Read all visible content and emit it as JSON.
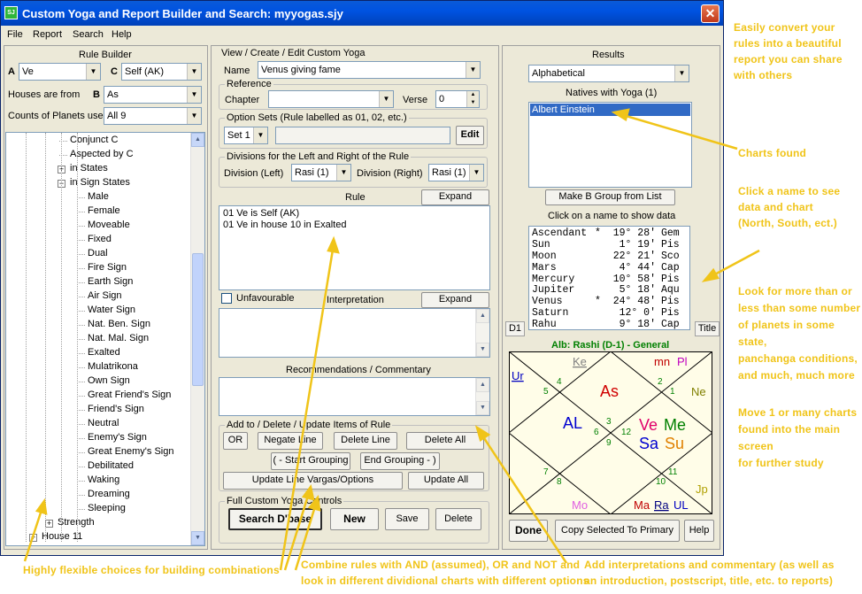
{
  "window": {
    "title": "Custom Yoga and Report Builder and Search: myyogas.sjy",
    "app_icon": "yoga-app-icon",
    "close": "✕"
  },
  "menu": [
    "File",
    "Report",
    "Search",
    "Help"
  ],
  "rule_builder": {
    "title": "Rule Builder",
    "a_label": "A",
    "a_value": "Ve",
    "c_label": "C",
    "c_value": "Self (AK)",
    "houses_label": "Houses are from",
    "b_label": "B",
    "b_value": "As",
    "counts_label": "Counts of Planets use",
    "counts_value": "All 9"
  },
  "tree": [
    {
      "label": "Conjunct C",
      "indent": 2,
      "exp": ""
    },
    {
      "label": "Aspected by C",
      "indent": 2,
      "exp": ""
    },
    {
      "label": "in States",
      "indent": 2,
      "exp": "+"
    },
    {
      "label": "in Sign States",
      "indent": 2,
      "exp": "-"
    },
    {
      "label": "Male",
      "indent": 3,
      "exp": ""
    },
    {
      "label": "Female",
      "indent": 3,
      "exp": ""
    },
    {
      "label": "Moveable",
      "indent": 3,
      "exp": ""
    },
    {
      "label": "Fixed",
      "indent": 3,
      "exp": ""
    },
    {
      "label": "Dual",
      "indent": 3,
      "exp": ""
    },
    {
      "label": "Fire Sign",
      "indent": 3,
      "exp": ""
    },
    {
      "label": "Earth Sign",
      "indent": 3,
      "exp": ""
    },
    {
      "label": "Air Sign",
      "indent": 3,
      "exp": ""
    },
    {
      "label": "Water Sign",
      "indent": 3,
      "exp": ""
    },
    {
      "label": "Nat. Ben. Sign",
      "indent": 3,
      "exp": ""
    },
    {
      "label": "Nat. Mal. Sign",
      "indent": 3,
      "exp": ""
    },
    {
      "label": "Exalted",
      "indent": 3,
      "exp": ""
    },
    {
      "label": "Mulatrikona",
      "indent": 3,
      "exp": ""
    },
    {
      "label": "Own Sign",
      "indent": 3,
      "exp": ""
    },
    {
      "label": "Great Friend's Sign",
      "indent": 3,
      "exp": ""
    },
    {
      "label": "Friend's Sign",
      "indent": 3,
      "exp": ""
    },
    {
      "label": "Neutral",
      "indent": 3,
      "exp": ""
    },
    {
      "label": "Enemy's Sign",
      "indent": 3,
      "exp": ""
    },
    {
      "label": "Great Enemy's Sign",
      "indent": 3,
      "exp": ""
    },
    {
      "label": "Debilitated",
      "indent": 3,
      "exp": ""
    },
    {
      "label": "Waking",
      "indent": 3,
      "exp": ""
    },
    {
      "label": "Dreaming",
      "indent": 3,
      "exp": ""
    },
    {
      "label": "Sleeping",
      "indent": 3,
      "exp": ""
    },
    {
      "label": "Strength",
      "indent": 1,
      "exp": "+"
    },
    {
      "label": "House 11",
      "indent": 0,
      "exp": "+"
    }
  ],
  "editor": {
    "section_title": "View / Create / Edit Custom Yoga",
    "name_label": "Name",
    "name_value": "Venus giving fame",
    "reference_title": "Reference",
    "chapter_label": "Chapter",
    "chapter_value": "",
    "verse_label": "Verse",
    "verse_value": "0",
    "option_sets_title": "Option Sets (Rule labelled as 01, 02, etc.)",
    "set_value": "Set 1",
    "set_text": "",
    "edit_label": "Edit",
    "divisions_title": "Divisions for the Left and Right of the Rule",
    "div_left_label": "Division (Left)",
    "div_left_value": "Rasi (1)",
    "div_right_label": "Division (Right)",
    "div_right_value": "Rasi (1)",
    "rule_header": "Rule",
    "expand_label": "Expand",
    "rule_lines": [
      "01  Ve is Self (AK)",
      "01  Ve in house 10 in Exalted"
    ],
    "unfavourable_label": "Unfavourable",
    "interpretation_header": "Interpretation",
    "interpretation_text": "",
    "recommendations_header": "Recommendations / Commentary",
    "recommendations_text": "",
    "items_title": "Add to / Delete / Update Items of Rule",
    "or_label": "OR",
    "negate_label": "Negate Line",
    "delete_line_label": "Delete Line",
    "delete_all_label": "Delete All",
    "start_grouping_label": "( - Start Grouping",
    "end_grouping_label": "End Grouping - )",
    "update_line_label": "Update Line Vargas/Options",
    "update_all_label": "Update All",
    "controls_title": "Full Custom Yoga Controls",
    "search_label": "Search D'base",
    "new_label": "New",
    "save_label": "Save",
    "delete_label": "Delete"
  },
  "results": {
    "title": "Results",
    "sort_value": "Alphabetical",
    "natives_label": "Natives with Yoga (1)",
    "natives": [
      "Albert Einstein"
    ],
    "make_group_label": "Make B Group from List",
    "click_hint": "Click on a name to show data",
    "planets": [
      [
        "Ascendant",
        "*",
        "19° 28'",
        "Gem"
      ],
      [
        "Sun",
        "",
        "1° 19'",
        "Pis"
      ],
      [
        "Moon",
        "",
        "22° 21'",
        "Sco"
      ],
      [
        "Mars",
        "",
        "4° 44'",
        "Cap"
      ],
      [
        "Mercury",
        "",
        "10° 58'",
        "Pis"
      ],
      [
        "Jupiter",
        "",
        "5° 18'",
        "Aqu"
      ],
      [
        "Venus",
        "*",
        "24° 48'",
        "Pis"
      ],
      [
        "Saturn",
        "",
        "12° 0'",
        "Pis"
      ],
      [
        "Rahu",
        "",
        "9° 18'",
        "Cap"
      ]
    ],
    "d1_tab": "D1",
    "title_tab": "Title",
    "chart_title": "Alb: Rashi (D-1) - General",
    "chart": {
      "houses": [
        "4",
        "5",
        "3",
        "6",
        "2",
        "1",
        "12",
        "9",
        "7",
        "8",
        "10",
        "11"
      ],
      "planets": {
        "top_left": "Ke",
        "top_right_a": "mn",
        "top_right_b": "Pl",
        "left_top": "Ur",
        "right_top": "Ne",
        "center_top": "As",
        "left_mid": "AL",
        "center_right_a": "Ve",
        "center_right_b": "Me",
        "center_right_c": "Sa",
        "center_right_d": "Su",
        "right_bottom": "Jp",
        "bottom_left": "Mo",
        "bottom_right_a": "Ma",
        "bottom_right_b": "Ra",
        "bottom_right_c": "UL"
      }
    },
    "done_label": "Done",
    "copy_label": "Copy Selected To Primary",
    "help_label": "Help"
  },
  "annotations": {
    "convert": [
      "Easily convert your",
      "rules into a beautiful",
      "report you can share",
      "with others"
    ],
    "charts_found": [
      "Charts found"
    ],
    "click_name": [
      "Click a name to see",
      "data and chart",
      "(North, South, ect.)"
    ],
    "look_more": [
      "Look for more than or",
      "less than some number",
      "of planets in some state,",
      "panchanga conditions,",
      "and much, much more"
    ],
    "move_charts": [
      "Move  1 or many charts",
      "found into the main screen",
      "for further study"
    ],
    "flexible": [
      "Highly flexible choices for building combinations"
    ],
    "combine": [
      "Combine rules with AND (assumed), OR and NOT and",
      "look in different dividional charts with different options"
    ],
    "add_interp": [
      "Add interpretations and commentary (as well as",
      "an introduction, postscript, title, etc. to reports)"
    ]
  },
  "colors": {
    "annotation": "#f0c419",
    "titlebar": "#0053e1",
    "chart_bg": "#fffde8"
  }
}
